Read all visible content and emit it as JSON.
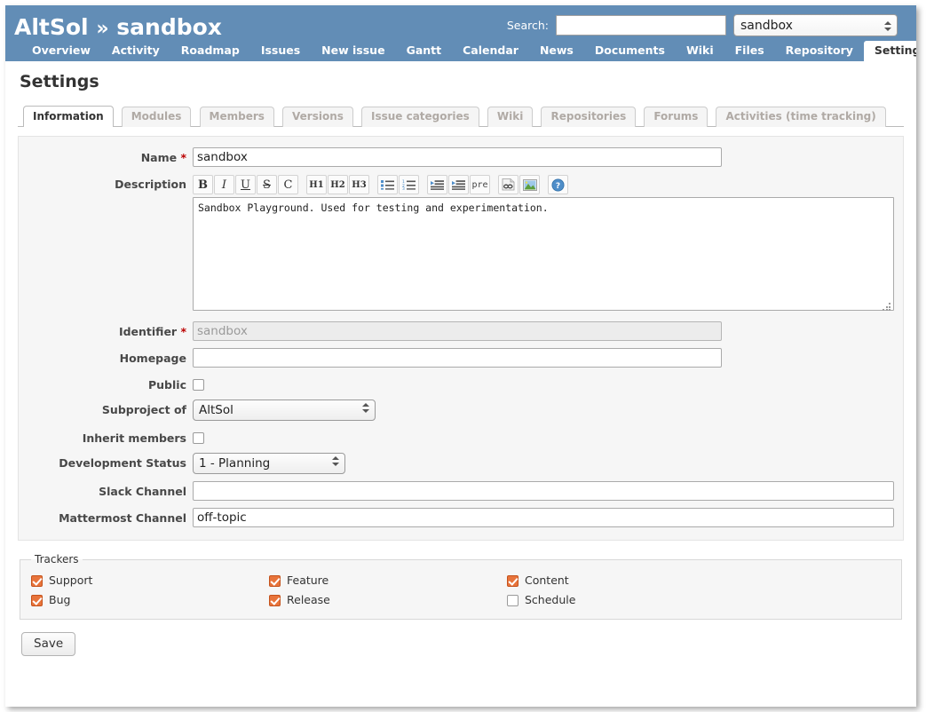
{
  "header": {
    "project_path_root": "AltSol",
    "project_path_sep": "»",
    "project_path_current": "sandbox",
    "search_label": "Search:",
    "search_value": "",
    "project_selector_value": "sandbox"
  },
  "mainmenu": [
    {
      "label": "Overview",
      "selected": false
    },
    {
      "label": "Activity",
      "selected": false
    },
    {
      "label": "Roadmap",
      "selected": false
    },
    {
      "label": "Issues",
      "selected": false
    },
    {
      "label": "New issue",
      "selected": false
    },
    {
      "label": "Gantt",
      "selected": false
    },
    {
      "label": "Calendar",
      "selected": false
    },
    {
      "label": "News",
      "selected": false
    },
    {
      "label": "Documents",
      "selected": false
    },
    {
      "label": "Wiki",
      "selected": false
    },
    {
      "label": "Files",
      "selected": false
    },
    {
      "label": "Repository",
      "selected": false
    },
    {
      "label": "Settings",
      "selected": true
    }
  ],
  "page": {
    "title": "Settings"
  },
  "tabs": [
    {
      "label": "Information",
      "selected": true
    },
    {
      "label": "Modules",
      "selected": false
    },
    {
      "label": "Members",
      "selected": false
    },
    {
      "label": "Versions",
      "selected": false
    },
    {
      "label": "Issue categories",
      "selected": false
    },
    {
      "label": "Wiki",
      "selected": false
    },
    {
      "label": "Repositories",
      "selected": false
    },
    {
      "label": "Forums",
      "selected": false
    },
    {
      "label": "Activities (time tracking)",
      "selected": false
    }
  ],
  "form": {
    "name": {
      "label": "Name",
      "required": "*",
      "value": "sandbox"
    },
    "description": {
      "label": "Description",
      "value": "Sandbox Playground. Used for testing and experimentation."
    },
    "identifier": {
      "label": "Identifier",
      "required": "*",
      "value": "sandbox",
      "readonly": true
    },
    "homepage": {
      "label": "Homepage",
      "value": ""
    },
    "public": {
      "label": "Public",
      "checked": false
    },
    "subproject_of": {
      "label": "Subproject of",
      "value": "AltSol"
    },
    "inherit_members": {
      "label": "Inherit members",
      "checked": false
    },
    "development_status": {
      "label": "Development Status",
      "value": "1 - Planning"
    },
    "slack_channel": {
      "label": "Slack Channel",
      "value": ""
    },
    "mattermost_channel": {
      "label": "Mattermost Channel",
      "value": "off-topic"
    }
  },
  "toolbar": [
    {
      "name": "bold-icon",
      "glyph": "B",
      "cls": "b"
    },
    {
      "name": "italic-icon",
      "glyph": "I",
      "cls": "i"
    },
    {
      "name": "underline-icon",
      "glyph": "U",
      "cls": "u"
    },
    {
      "name": "strikethrough-icon",
      "glyph": "S",
      "cls": "s"
    },
    {
      "name": "code-icon",
      "glyph": "C",
      "cls": "c"
    },
    {
      "name": "heading-1-icon",
      "glyph": "H1",
      "cls": "hh"
    },
    {
      "name": "heading-2-icon",
      "glyph": "H2",
      "cls": "hh"
    },
    {
      "name": "heading-3-icon",
      "glyph": "H3",
      "cls": "hh"
    },
    {
      "name": "unordered-list-icon",
      "glyph": "",
      "cls": "ul"
    },
    {
      "name": "ordered-list-icon",
      "glyph": "",
      "cls": "ol"
    },
    {
      "name": "quote-icon",
      "glyph": "",
      "cls": "q1"
    },
    {
      "name": "unquote-icon",
      "glyph": "",
      "cls": "q2"
    },
    {
      "name": "preformatted-icon",
      "glyph": "pre",
      "cls": "pre"
    },
    {
      "name": "link-icon",
      "glyph": "",
      "cls": "lnk"
    },
    {
      "name": "image-icon",
      "glyph": "",
      "cls": "img"
    },
    {
      "name": "help-icon",
      "glyph": "",
      "cls": "hlp"
    }
  ],
  "trackers": {
    "legend": "Trackers",
    "items": [
      {
        "label": "Support",
        "checked": true
      },
      {
        "label": "Feature",
        "checked": true
      },
      {
        "label": "Content",
        "checked": true
      },
      {
        "label": "Bug",
        "checked": true
      },
      {
        "label": "Release",
        "checked": true
      },
      {
        "label": "Schedule",
        "checked": false
      }
    ]
  },
  "actions": {
    "save_label": "Save"
  },
  "colors": {
    "banner": "#628db6",
    "tracker_checked": "#e8743b",
    "required": "#bb0000",
    "box_bg": "#f6f6f6"
  }
}
